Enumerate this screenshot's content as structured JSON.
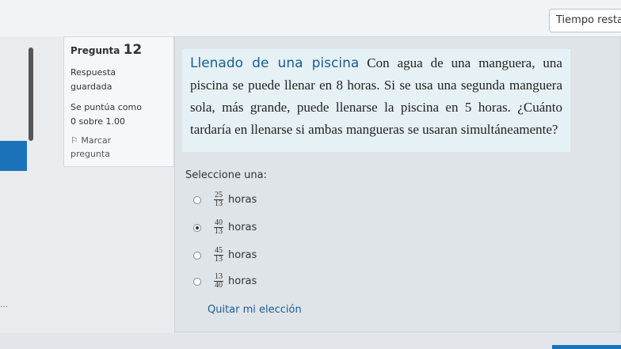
{
  "timer_label": "Tiempo resta",
  "question": {
    "label": "Pregunta",
    "number": "12",
    "status_line1": "Respuesta",
    "status_line2": "guardada",
    "score_line1": "Se puntúa como",
    "score_line2": "0 sobre 1.00",
    "flag_line1": "Marcar",
    "flag_line2": "pregunta",
    "title": "Llenado de una piscina",
    "text": " Con agua de una manguera, una piscina se puede llenar en 8 horas. Si se usa una segunda manguera sola, más grande, puede llenarse la piscina en 5 horas. ¿Cuánto tardaría en llenarse si ambas mangueras se usaran simultáneamente?"
  },
  "prompt": "Seleccione una:",
  "options": [
    {
      "num": "25",
      "den": "13",
      "unit": "horas",
      "selected": false
    },
    {
      "num": "40",
      "den": "13",
      "unit": "horas",
      "selected": true
    },
    {
      "num": "45",
      "den": "13",
      "unit": "horas",
      "selected": false
    },
    {
      "num": "13",
      "den": "40",
      "unit": "horas",
      "selected": false
    }
  ],
  "clear_choice": "Quitar mi elección",
  "colors": {
    "accent": "#1a5d96",
    "brand_blue": "#1a73b8"
  }
}
